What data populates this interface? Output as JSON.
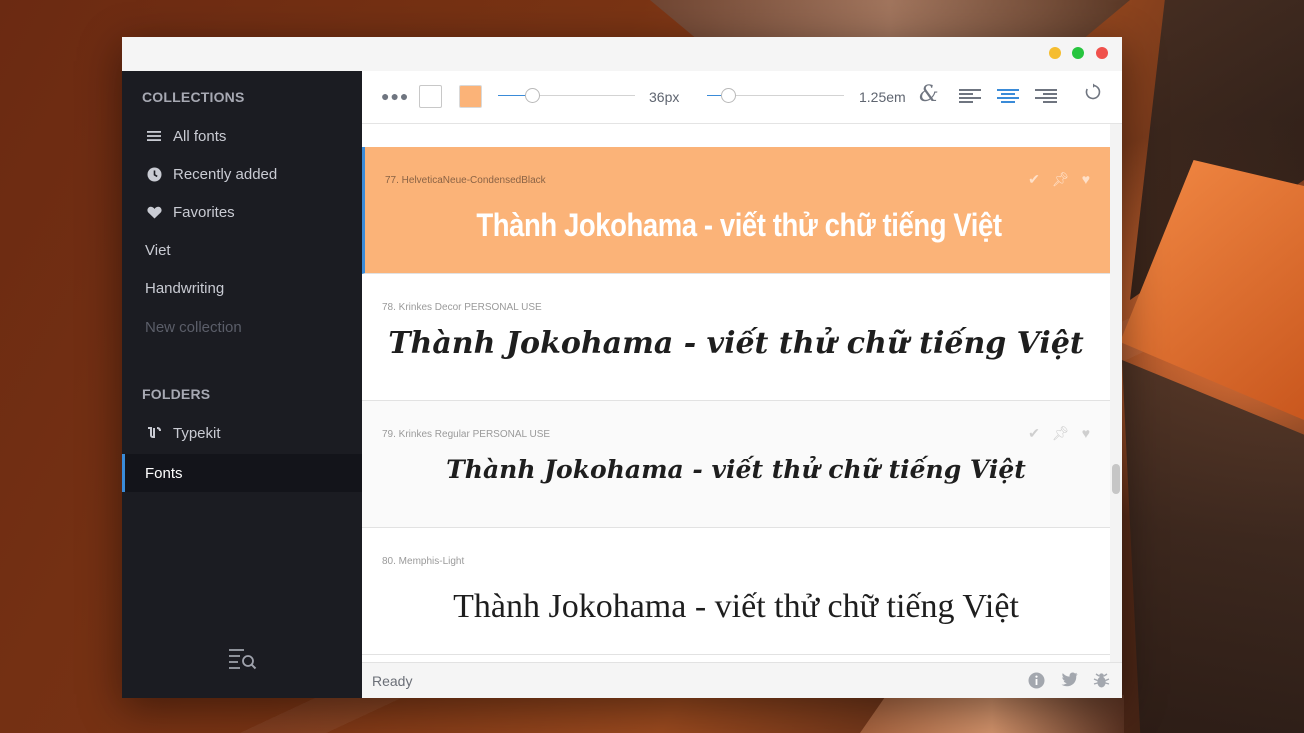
{
  "window": {
    "controls": [
      "minimize",
      "maximize",
      "close"
    ]
  },
  "sidebar": {
    "collections_heading": "COLLECTIONS",
    "collections": [
      {
        "label": "All fonts",
        "icon": "list-icon"
      },
      {
        "label": "Recently added",
        "icon": "clock-icon"
      },
      {
        "label": "Favorites",
        "icon": "heart-icon"
      },
      {
        "label": "Viet",
        "icon": ""
      },
      {
        "label": "Handwriting",
        "icon": ""
      }
    ],
    "new_collection": "New collection",
    "folders_heading": "FOLDERS",
    "folders": [
      {
        "label": "Typekit",
        "icon": "typekit-icon"
      },
      {
        "label": "Fonts",
        "icon": "",
        "active": true
      }
    ],
    "bottom_icon": "search-list-icon"
  },
  "toolbar": {
    "menu_icon": "more-dots-icon",
    "text_color": "#ffffff",
    "background_color": "#fbb378",
    "font_size_value": "36px",
    "font_size_level": 0.25,
    "line_height_value": "1.25em",
    "line_height_level": 0.15,
    "ligature_icon": "ampersand-icon",
    "alignments": [
      "align-left",
      "align-center",
      "align-right"
    ],
    "active_alignment": "align-center",
    "reset_icon": "reset-icon"
  },
  "fonts": [
    {
      "meta": "77. HelveticaNeue-CondensedBlack",
      "sample": "Thành Jokohama - viết thử chữ tiếng Việt",
      "selected": true
    },
    {
      "meta": "78. Krinkes Decor PERSONAL USE",
      "sample": "Thành Jokohama - viết thử chữ tiếng Việt",
      "selected": false
    },
    {
      "meta": "79. Krinkes Regular PERSONAL USE",
      "sample": "Thành Jokohama - viết thử chữ tiếng Việt",
      "selected": false
    },
    {
      "meta": "80. Memphis-Light",
      "sample": "Thành Jokohama - viết thử chữ tiếng Việt",
      "selected": false
    }
  ],
  "status": {
    "text": "Ready",
    "icons": [
      "info-icon",
      "twitter-icon",
      "bug-icon"
    ]
  },
  "colors": {
    "accent": "#3a8bd8",
    "selection": "#fbb378",
    "sidebar_bg": "#1b1c22"
  }
}
